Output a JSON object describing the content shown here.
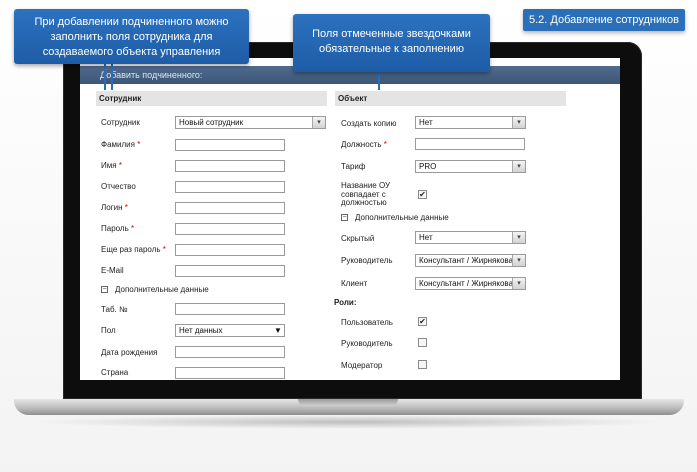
{
  "slide_tag": "5.2. Добавление сотрудников",
  "callouts": {
    "left": "При добавлении подчиненного можно заполнить поля сотрудника для создаваемого объекта управления",
    "center": "Поля отмеченные звездочками обязательные к заполнению"
  },
  "dialog": {
    "title": "Добавить подчиненного:",
    "employee": {
      "title": "Сотрудник",
      "employee_label": "Сотрудник",
      "employee_value": "Новый сотрудник",
      "surname_label": "Фамилия",
      "name_label": "Имя",
      "patronymic_label": "Отчество",
      "login_label": "Логин",
      "password_label": "Пароль",
      "password_repeat_label": "Еще раз пароль",
      "email_label": "E-Mail",
      "additional_label": "Дополнительные данные",
      "tab_no_label": "Таб. №",
      "gender_label": "Пол",
      "gender_value": "Нет данных",
      "birth_date_label": "Дата рождения",
      "country_label": "Страна",
      "required_mark": "*"
    },
    "object": {
      "title": "Объект",
      "copy_label": "Создать копию",
      "copy_value": "Нет",
      "position_label": "Должность",
      "tariff_label": "Тариф",
      "tariff_value": "PRO",
      "name_match_label": "Название ОУ совпадает с должностью",
      "name_match_checked": true,
      "additional_label": "Дополнительные данные",
      "hidden_label": "Скрытый",
      "hidden_value": "Нет",
      "manager_label": "Руководитель",
      "manager_value": "Консультант / Жирнякова",
      "client_label": "Клиент",
      "client_value": "Консультант / Жирнякова",
      "required_mark": "*"
    },
    "roles": {
      "title": "Роли:",
      "user_label": "Пользователь",
      "user_checked": true,
      "manager_label": "Руководитель",
      "manager_checked": false,
      "moderator_label": "Модератор",
      "moderator_checked": false
    }
  },
  "icons": {
    "dropdown": "▾",
    "dropdown_solid": "▼",
    "check": "✔",
    "collapse": "−"
  },
  "colors": {
    "callout_blue": "#2c72c0",
    "header_bar": "#4f6b8e",
    "section_gray": "#e4e4e4",
    "required_red": "#cc0000"
  }
}
